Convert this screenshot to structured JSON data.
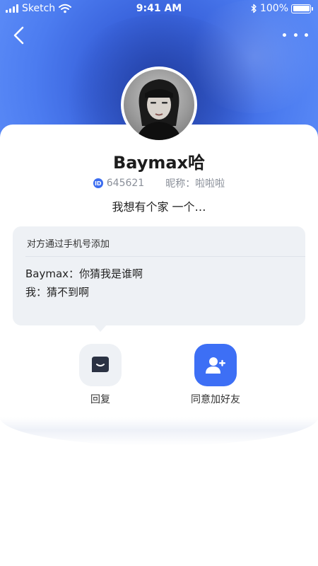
{
  "status_bar": {
    "carrier": "Sketch",
    "time": "9:41 AM",
    "battery": "100%"
  },
  "nav": {
    "back_icon": "chevron-left-icon",
    "more_icon": "more-icon"
  },
  "profile": {
    "name": "Baymax哈",
    "id": "645621",
    "nickname": "昵称：啦啦啦",
    "bio": "我想有个家 一个…"
  },
  "request": {
    "source": "对方通过手机号添加",
    "messages": [
      "Baymax：你猜我是谁啊",
      "我：猜不到啊"
    ]
  },
  "actions": {
    "reply_label": "回复",
    "accept_label": "同意加好友"
  },
  "colors": {
    "accent": "#3d6ff5",
    "hero": "#3a64dd",
    "panel": "#eef1f5"
  }
}
